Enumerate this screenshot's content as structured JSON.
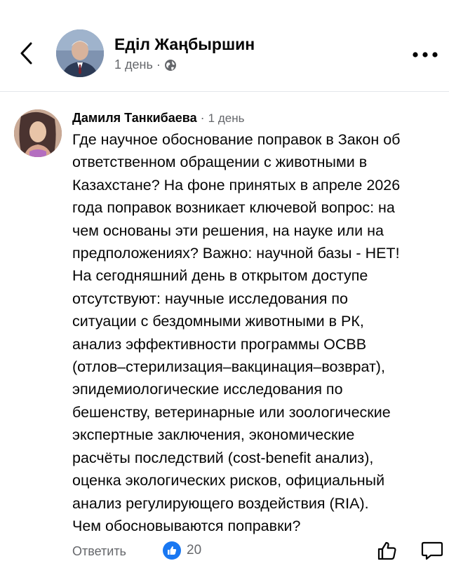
{
  "header": {
    "author_name": "Еділ Жаңбыршин",
    "time": "1 день",
    "separator": "·",
    "privacy_icon": "globe-icon",
    "back_icon": "chevron-left-icon",
    "more_icon": "more-horizontal-icon"
  },
  "comment": {
    "author_name": "Дамиля Танкибаева",
    "separator": "·",
    "time": "1 день",
    "lines": [
      "Где научное обоснование поправок в Закон об",
      "ответственном обращении с животными в",
      "Казахстане? На фоне принятых в апреле 2026",
      "года поправок возникает ключевой вопрос: на",
      "чем основаны эти решения, на науке или на",
      "предположениях? Важно: научной базы - НЕТ!",
      "На сегодняшний день в открытом доступе",
      "отсутствуют: научные исследования по",
      "ситуации с бездомными животными в РК,",
      "анализ эффективности программы ОСВВ",
      "(отлов–стерилизация–вакцинация–возврат),",
      "эпидемиологические исследования по",
      "бешенству, ветеринарные или зоологические",
      "экспертные заключения, экономические",
      "расчёты последствий (cost-benefit анализ),",
      "оценка экологических рисков, официальный",
      "анализ регулирующего воздействия (RIA).",
      "Чем обосновываются поправки?"
    ]
  },
  "actions": {
    "reply_label": "Ответить",
    "like_count": "20",
    "like_icon": "like-thumb-icon",
    "thumb_icon": "thumb-up-outline-icon",
    "chat_icon": "comment-bubble-icon"
  },
  "colors": {
    "accent": "#1877f2",
    "secondary_text": "#65676b",
    "divider": "#e4e6eb"
  }
}
